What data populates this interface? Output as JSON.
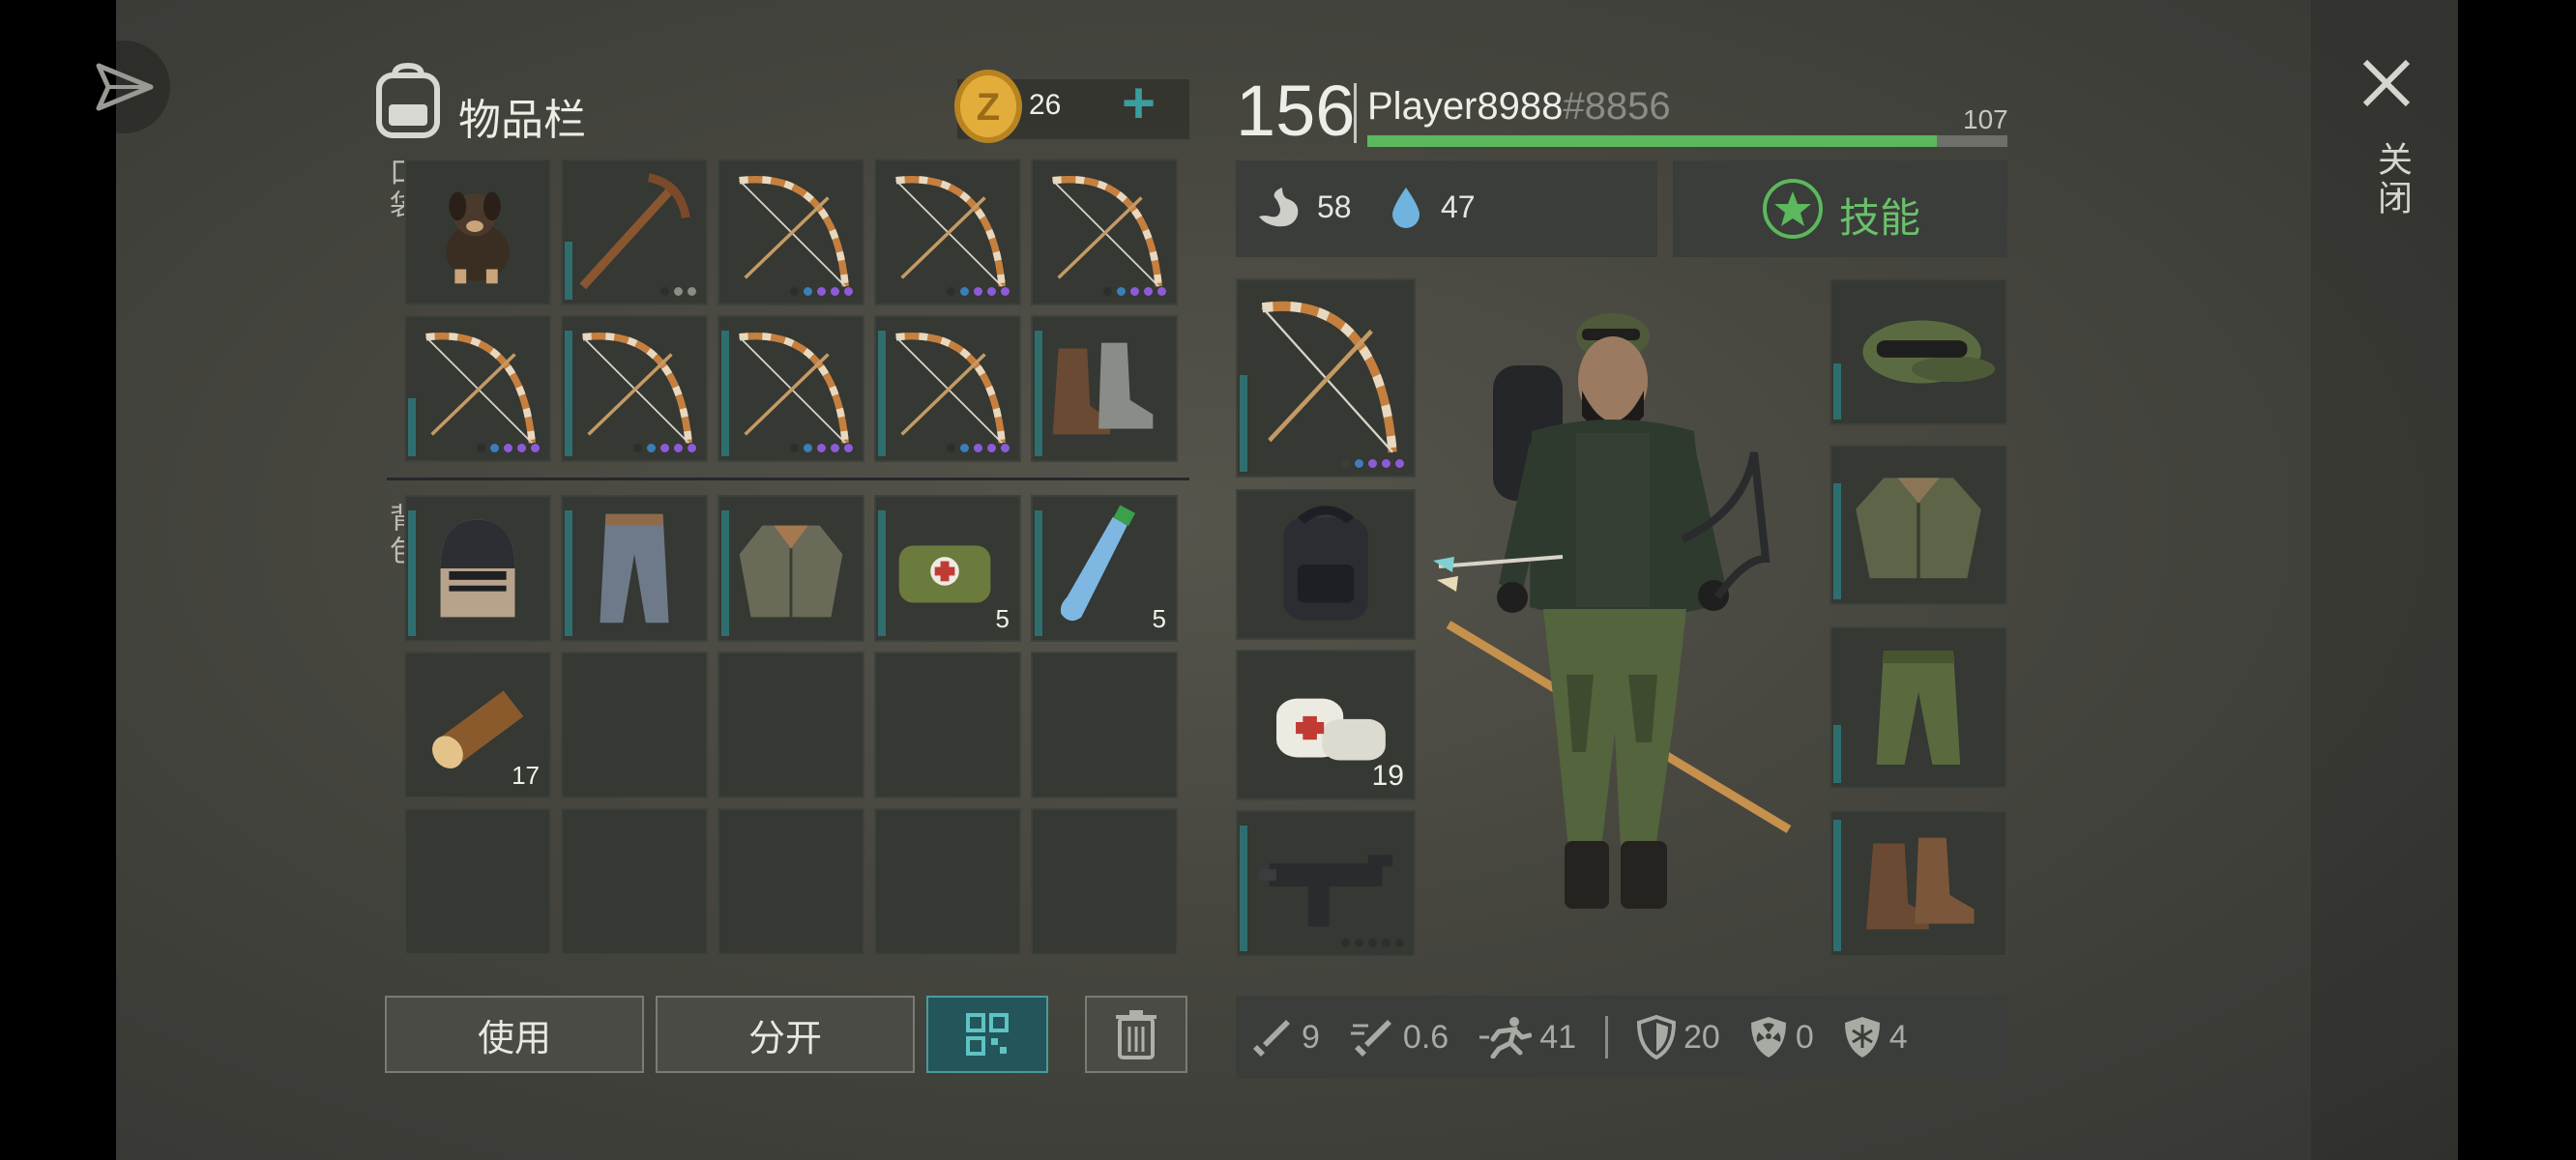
{
  "inventory": {
    "title": "物品栏",
    "pockets_label": "口袋",
    "pockets_marker": "I",
    "backpack_label": "背包",
    "coins": "26",
    "add_label": "+",
    "pockets": [
      {
        "item": "puppy-icon",
        "qty": ""
      },
      {
        "item": "pickaxe-icon",
        "qty": ""
      },
      {
        "item": "bow-icon",
        "qty": ""
      },
      {
        "item": "bow-icon",
        "qty": ""
      },
      {
        "item": "bow-icon",
        "qty": ""
      },
      {
        "item": "bow-icon",
        "qty": ""
      },
      {
        "item": "bow-icon",
        "qty": ""
      },
      {
        "item": "bow-icon",
        "qty": ""
      },
      {
        "item": "bow-icon",
        "qty": ""
      },
      {
        "item": "boots-icon",
        "qty": ""
      }
    ],
    "backpack": [
      {
        "item": "helmet-icon",
        "qty": ""
      },
      {
        "item": "pants-icon",
        "qty": ""
      },
      {
        "item": "jacket-icon",
        "qty": ""
      },
      {
        "item": "medkit-bag-icon",
        "qty": "5"
      },
      {
        "item": "water-bottle-icon",
        "qty": "5"
      },
      {
        "item": "log-icon",
        "qty": "17"
      }
    ]
  },
  "actions": {
    "use": "使用",
    "split": "分开"
  },
  "player": {
    "level": "156",
    "name": "Player8988",
    "tag": "#8856",
    "xp_value": "107",
    "xp_progress": 0.89,
    "hunger": "58",
    "thirst": "47",
    "skills_label": "技能"
  },
  "equipment": {
    "bandage_qty": "19",
    "left": [
      "bow-icon",
      "backpack-icon",
      "bandage-icon",
      "smg-icon"
    ],
    "right": [
      "cap-icon",
      "jacket-icon",
      "pants-icon",
      "boots-icon"
    ]
  },
  "stats": {
    "attack": "9",
    "attack_speed": "0.6",
    "speed": "41",
    "armor": "20",
    "radiation": "0",
    "cold": "4"
  },
  "close_label": "关闭",
  "colors": {
    "accent": "#5cb85c",
    "teal": "#2f6e6e",
    "gold": "#d9a531",
    "rarity_purple": "#8e5bd8",
    "rarity_blue": "#3a7fb8"
  }
}
